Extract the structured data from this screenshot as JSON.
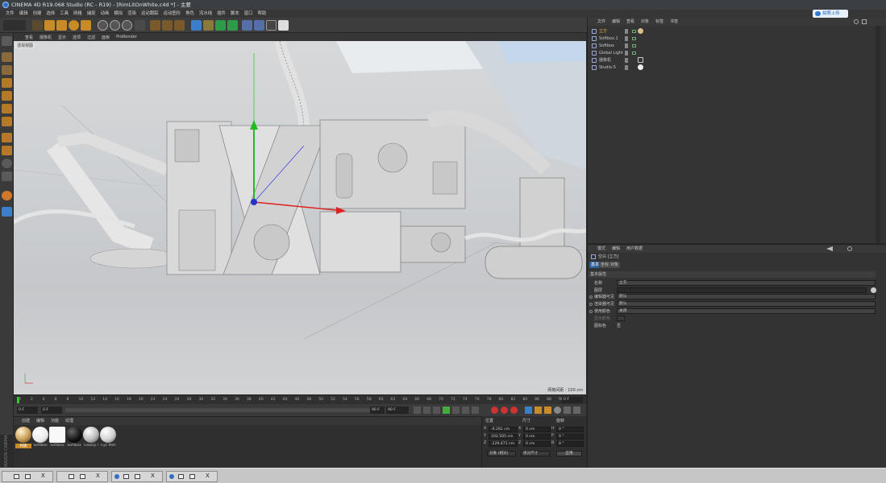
{
  "window": {
    "title": "CINEMA 4D R19.068 Studio (RC - R19) - [RimLitOnWhite.c4d *] - 主要"
  },
  "menu": [
    "文件",
    "编辑",
    "创建",
    "选择",
    "工具",
    "网格",
    "捕捉",
    "动画",
    "模拟",
    "渲染",
    "运动跟踪",
    "运动图形",
    "角色",
    "流水线",
    "插件",
    "脚本",
    "窗口",
    "帮助"
  ],
  "upload": {
    "label": "拍照上传"
  },
  "viewport": {
    "menu": [
      "查看",
      "摄像机",
      "显示",
      "选项",
      "过滤",
      "面板",
      "ProRender"
    ],
    "label": "透视视图",
    "grid": "网格间距 : 100 cm"
  },
  "timeline": {
    "ticks": [
      "0",
      "2",
      "4",
      "6",
      "8",
      "10",
      "12",
      "14",
      "16",
      "18",
      "20",
      "22",
      "24",
      "26",
      "28",
      "30",
      "32",
      "34",
      "36",
      "38",
      "40",
      "42",
      "44",
      "46",
      "48",
      "50",
      "52",
      "54",
      "56",
      "58",
      "60",
      "62",
      "64",
      "66",
      "68",
      "70",
      "72",
      "74",
      "76",
      "78",
      "80",
      "82",
      "84",
      "86",
      "88",
      "90"
    ],
    "end_frame": "0 F"
  },
  "playback": {
    "start": "0 F",
    "cur": "0 F",
    "end": "90 F",
    "end2": "90 F"
  },
  "materials": {
    "menu": [
      "创建",
      "编辑",
      "功能",
      "纹理"
    ],
    "items": [
      {
        "label": "材质",
        "color": "#c89b54"
      },
      {
        "label": "Softbox",
        "color": "#f2f2f2"
      },
      {
        "label": "Softbox",
        "color": "#f8f8f8"
      },
      {
        "label": "Softbox",
        "color": "#111111"
      },
      {
        "label": "Glossy I",
        "color": "#bbbbbb"
      },
      {
        "label": "Cyc Mat",
        "color": "#d0d0d0"
      }
    ]
  },
  "coords": {
    "headers": [
      "位置",
      "尺寸",
      "旋转"
    ],
    "rows": [
      {
        "a": "X",
        "pos": "-0.281 cm",
        "b": "X",
        "size": "0 cm",
        "c": "H",
        "rot": "0 °"
      },
      {
        "a": "Y",
        "pos": "102.505 cm",
        "b": "Y",
        "size": "0 cm",
        "c": "P",
        "rot": "0 °"
      },
      {
        "a": "Z",
        "pos": "-229.471 cm",
        "b": "Z",
        "size": "0 cm",
        "c": "B",
        "rot": "0 °"
      }
    ],
    "mode": "对象 (相对)",
    "size_mode": "绝对尺寸",
    "apply": "应用"
  },
  "objects": {
    "menu": [
      "文件",
      "编辑",
      "查看",
      "对象",
      "标签",
      "书签"
    ],
    "items": [
      {
        "name": "立方",
        "tag": "#d8c08a"
      },
      {
        "name": "Softbox.1",
        "tag": ""
      },
      {
        "name": "Softbox",
        "tag": ""
      },
      {
        "name": "Global Light",
        "tag": ""
      },
      {
        "name": "摄像机",
        "tag": ""
      },
      {
        "name": "Studio-5",
        "tag": "#eeeeee"
      }
    ]
  },
  "attributes": {
    "menu": [
      "模式",
      "编辑",
      "用户数据"
    ],
    "header": "空白 [立方]",
    "tabs": [
      "基本",
      "坐标",
      "对象"
    ],
    "section": "基本属性",
    "fields": [
      {
        "label": "名称",
        "value": "立方"
      },
      {
        "label": "图层",
        "value": ""
      },
      {
        "label": "编辑器可见",
        "value": "默认"
      },
      {
        "label": "渲染器可见",
        "value": "默认"
      },
      {
        "label": "使用颜色",
        "value": "关闭"
      },
      {
        "label": "显示颜色",
        "value": ""
      },
      {
        "label": "图标色",
        "value": "否"
      }
    ]
  },
  "side_brand": "MAXON CINEMA 4D",
  "taskbar": {
    "close": "X"
  }
}
